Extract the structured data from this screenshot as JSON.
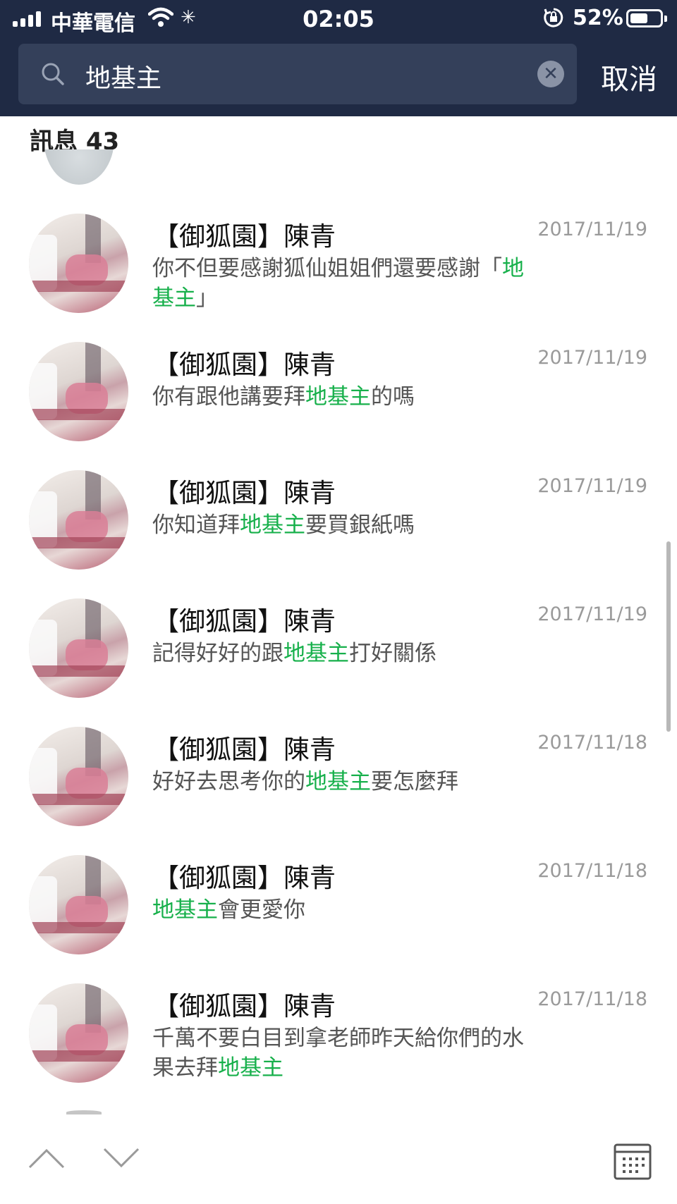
{
  "status_bar": {
    "carrier": "中華電信",
    "time": "02:05",
    "battery_percent": "52%",
    "battery_level": 0.52,
    "icons": [
      "signal-icon",
      "wifi-icon",
      "activity-icon",
      "rotation-lock-icon",
      "battery-icon"
    ]
  },
  "search": {
    "query": "地基主",
    "cancel_label": "取消",
    "icons": [
      "search-icon",
      "clear-icon"
    ]
  },
  "section": {
    "title": "訊息 43"
  },
  "results": [
    {
      "name": "【御狐園】陳青",
      "date": "2017/11/19",
      "msg": [
        {
          "t": "你不但要感謝狐仙姐姐們還要感謝「"
        },
        {
          "t": "地基主",
          "hl": true
        },
        {
          "t": "」"
        }
      ]
    },
    {
      "name": "【御狐園】陳青",
      "date": "2017/11/19",
      "msg": [
        {
          "t": "你有跟他講要拜"
        },
        {
          "t": "地基主",
          "hl": true
        },
        {
          "t": "的嗎"
        }
      ]
    },
    {
      "name": "【御狐園】陳青",
      "date": "2017/11/19",
      "msg": [
        {
          "t": "你知道拜"
        },
        {
          "t": "地基主",
          "hl": true
        },
        {
          "t": "要買銀紙嗎"
        }
      ]
    },
    {
      "name": "【御狐園】陳青",
      "date": "2017/11/19",
      "msg": [
        {
          "t": "記得好好的跟"
        },
        {
          "t": "地基主",
          "hl": true
        },
        {
          "t": "打好關係"
        }
      ]
    },
    {
      "name": "【御狐園】陳青",
      "date": "2017/11/18",
      "msg": [
        {
          "t": "好好去思考你的"
        },
        {
          "t": "地基主",
          "hl": true
        },
        {
          "t": "要怎麼拜"
        }
      ]
    },
    {
      "name": "【御狐園】陳青",
      "date": "2017/11/18",
      "msg": [
        {
          "t": "地基主",
          "hl": true
        },
        {
          "t": "會更愛你"
        }
      ]
    },
    {
      "name": "【御狐園】陳青",
      "date": "2017/11/18",
      "msg": [
        {
          "t": "千萬不要白目到拿老師昨天給你們的水果去拜"
        },
        {
          "t": "地基主",
          "hl": true
        }
      ]
    }
  ],
  "bottom_bar": {
    "icons": [
      "chevron-up-icon",
      "chevron-down-icon",
      "calendar-icon"
    ]
  },
  "colors": {
    "header_bg": "#1f2a44",
    "search_bg": "#34405a",
    "highlight": "#17b04b",
    "date_text": "#9a9a9a"
  }
}
